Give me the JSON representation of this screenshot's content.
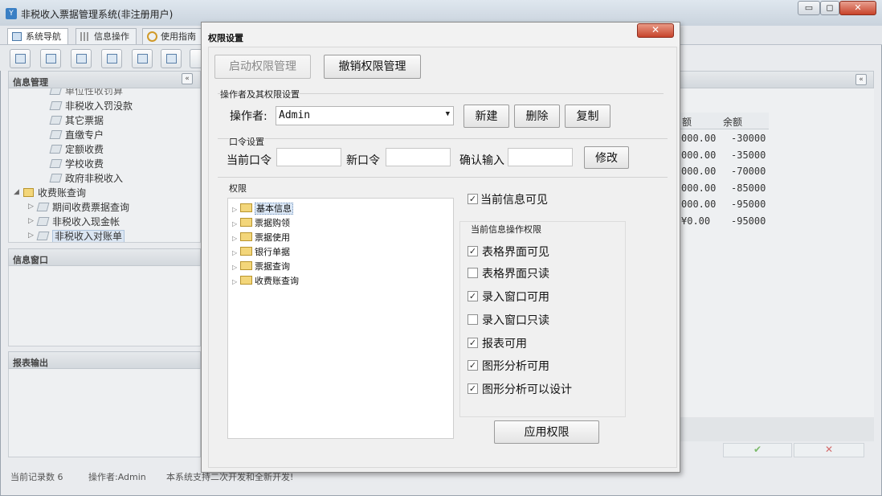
{
  "app": {
    "title": "非税收入票据管理系统(非注册用户)",
    "min": "▭",
    "max": "◻",
    "close": "✕"
  },
  "nav_tabs": [
    {
      "label": "系统导航"
    },
    {
      "label": "信息操作"
    },
    {
      "label": "使用指南"
    }
  ],
  "left_panel": {
    "info_mgmt": "信息管理",
    "collapse_symbol": "«",
    "tree": [
      {
        "label": "单位性收罚算"
      },
      {
        "label": "非税收入罚没款"
      },
      {
        "label": "其它票据"
      },
      {
        "label": "直缴专户"
      },
      {
        "label": "定额收费"
      },
      {
        "label": "学校收费"
      },
      {
        "label": "政府非税收入"
      },
      {
        "label": "收费账查询"
      },
      {
        "label": "期间收费票据查询"
      },
      {
        "label": "非税收入现金帐"
      },
      {
        "label": "非税收入对账单"
      }
    ],
    "info_window": "信息窗口",
    "report_output": "报表输出"
  },
  "right_grid": {
    "expand_symbol": "«",
    "headers": [
      "额",
      "余额"
    ],
    "rows": [
      [
        "000.00",
        "-30000"
      ],
      [
        "000.00",
        "-35000"
      ],
      [
        "000.00",
        "-70000"
      ],
      [
        "000.00",
        "-85000"
      ],
      [
        "000.00",
        "-95000"
      ],
      [
        "¥0.00",
        "-95000"
      ]
    ],
    "footer_icons": {
      "check": "✔",
      "cross": "✕"
    }
  },
  "status": {
    "records": "当前记录数 6",
    "operator": "操作者:Admin",
    "note": "本系统支持二次开发和全新开发!"
  },
  "dialog": {
    "title": "权限设置",
    "close": "✕",
    "enable_btn": "启动权限管理",
    "revoke_btn": "撤销权限管理",
    "op_group": "操作者及其权限设置",
    "operator_label": "操作者:",
    "operator_value": "Admin",
    "new_btn": "新建",
    "delete_btn": "删除",
    "copy_btn": "复制",
    "pwd_group": "口令设置",
    "current_pwd": "当前口令",
    "new_pwd": "新口令",
    "confirm_pwd": "确认输入",
    "modify_btn": "修改",
    "perm_group": "权限",
    "perm_tree": [
      {
        "label": "基本信息",
        "selected": true
      },
      {
        "label": "票据购领"
      },
      {
        "label": "票据使用"
      },
      {
        "label": "银行单据"
      },
      {
        "label": "票据查询"
      },
      {
        "label": "收费账查询"
      }
    ],
    "visible_label": "当前信息可见",
    "visible_checked": true,
    "ops_group": "当前信息操作权限",
    "ops": [
      {
        "label": "表格界面可见",
        "checked": true
      },
      {
        "label": "表格界面只读",
        "checked": false
      },
      {
        "label": "录入窗口可用",
        "checked": true
      },
      {
        "label": "录入窗口只读",
        "checked": false
      },
      {
        "label": "报表可用",
        "checked": true
      },
      {
        "label": "图形分析可用",
        "checked": true
      },
      {
        "label": "图形分析可以设计",
        "checked": true
      }
    ],
    "apply_btn": "应用权限",
    "check_mark": "✓"
  }
}
